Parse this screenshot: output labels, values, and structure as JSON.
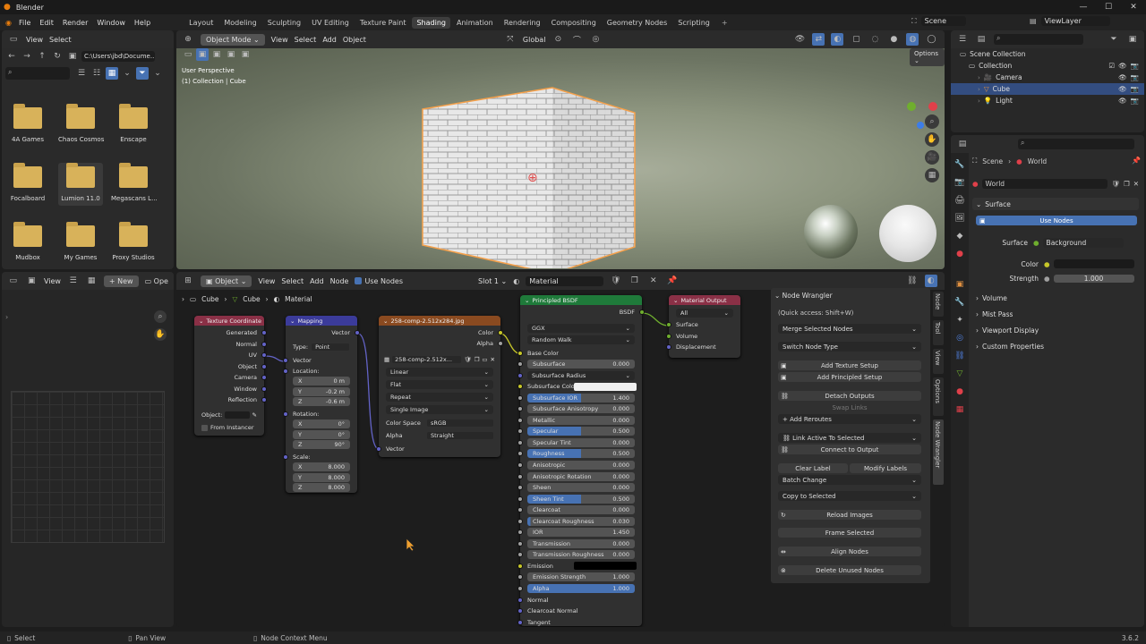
{
  "app": {
    "title": "Blender",
    "version": "3.6.2"
  },
  "menu": [
    "File",
    "Edit",
    "Render",
    "Window",
    "Help"
  ],
  "workspaces": [
    "Layout",
    "Modeling",
    "Sculpting",
    "UV Editing",
    "Texture Paint",
    "Shading",
    "Animation",
    "Rendering",
    "Compositing",
    "Geometry Nodes",
    "Scripting"
  ],
  "active_workspace": "Shading",
  "scene": "Scene",
  "view_layer": "ViewLayer",
  "file_browser": {
    "menu": [
      "View",
      "Select"
    ],
    "path": "C:\\Users\\jbd\\Docume...",
    "folders": [
      "4A Games",
      "Chaos Cosmos",
      "Enscape",
      "Focalboard",
      "Lumion 11.0",
      "Megascans L...",
      "Mudbox",
      "My Games",
      "Proxy Studios"
    ]
  },
  "viewport": {
    "mode": "Object Mode",
    "menu": [
      "View",
      "Select",
      "Add",
      "Object"
    ],
    "transform": "Global",
    "info_line1": "User Perspective",
    "info_line2": "(1) Collection | Cube",
    "options": "Options"
  },
  "outliner": {
    "root": "Scene Collection",
    "items": [
      {
        "label": "Collection",
        "indent": 1
      },
      {
        "label": "Camera",
        "indent": 2
      },
      {
        "label": "Cube",
        "indent": 2
      },
      {
        "label": "Light",
        "indent": 2
      }
    ]
  },
  "properties": {
    "breadcrumb_scene": "Scene",
    "breadcrumb_world": "World",
    "world_name": "World",
    "surface_panel": "Surface",
    "use_nodes": "Use Nodes",
    "surface_label": "Surface",
    "surface_value": "Background",
    "color_label": "Color",
    "strength_label": "Strength",
    "strength_value": "1.000",
    "panels": [
      "Volume",
      "Mist Pass",
      "Viewport Display",
      "Custom Properties"
    ]
  },
  "node_editor": {
    "header": {
      "object": "Object",
      "menu": [
        "View",
        "Select",
        "Add",
        "Node"
      ],
      "use_nodes": "Use Nodes",
      "slot": "Slot 1",
      "material": "Material"
    },
    "breadcrumb": [
      "Cube",
      "Cube",
      "Material"
    ],
    "left_header": {
      "view": "View",
      "new": "New",
      "open": "Ope"
    },
    "tex_coord": {
      "title": "Texture Coordinate",
      "outputs": [
        "Generated",
        "Normal",
        "UV",
        "Object",
        "Camera",
        "Window",
        "Reflection"
      ],
      "object_label": "Object:",
      "from_instancer": "From Instancer"
    },
    "mapping": {
      "title": "Mapping",
      "output": "Vector",
      "type_label": "Type:",
      "type_value": "Point",
      "vector": "Vector",
      "location": "Location:",
      "loc": [
        [
          "X",
          "0 m"
        ],
        [
          "Y",
          "-0.2 m"
        ],
        [
          "Z",
          "-0.6 m"
        ]
      ],
      "rotation": "Rotation:",
      "rot": [
        [
          "X",
          "0°"
        ],
        [
          "Y",
          "0°"
        ],
        [
          "Z",
          "90°"
        ]
      ],
      "scale": "Scale:",
      "scl": [
        [
          "X",
          "8.000"
        ],
        [
          "Y",
          "8.000"
        ],
        [
          "Z",
          "8.000"
        ]
      ]
    },
    "image": {
      "title": "258-comp-2.512x284.jpg",
      "outputs": [
        "Color",
        "Alpha"
      ],
      "image_name": "258-comp-2.512x...",
      "interp": "Linear",
      "proj": "Flat",
      "ext": "Repeat",
      "source": "Single Image",
      "cs_label": "Color Space",
      "cs_value": "sRGB",
      "alpha_label": "Alpha",
      "alpha_value": "Straight",
      "vector": "Vector"
    },
    "bsdf": {
      "title": "Principled BSDF",
      "output": "BSDF",
      "dist": "GGX",
      "sss": "Random Walk",
      "base_color": "Base Color",
      "rows": [
        {
          "label": "Subsurface",
          "value": "0.000",
          "fill": 0
        },
        {
          "label": "Subsurface Radius",
          "value": "",
          "fill": -1
        },
        {
          "label": "Subsurface Color",
          "value": "",
          "fill": -2
        },
        {
          "label": "Subsurface IOR",
          "value": "1.400",
          "fill": 0.5
        },
        {
          "label": "Subsurface Anisotropy",
          "value": "0.000",
          "fill": 0
        },
        {
          "label": "Metallic",
          "value": "0.000",
          "fill": 0
        },
        {
          "label": "Specular",
          "value": "0.500",
          "fill": 0.5
        },
        {
          "label": "Specular Tint",
          "value": "0.000",
          "fill": 0
        },
        {
          "label": "Roughness",
          "value": "0.500",
          "fill": 0.5
        },
        {
          "label": "Anisotropic",
          "value": "0.000",
          "fill": 0
        },
        {
          "label": "Anisotropic Rotation",
          "value": "0.000",
          "fill": 0
        },
        {
          "label": "Sheen",
          "value": "0.000",
          "fill": 0
        },
        {
          "label": "Sheen Tint",
          "value": "0.500",
          "fill": 0.5
        },
        {
          "label": "Clearcoat",
          "value": "0.000",
          "fill": 0
        },
        {
          "label": "Clearcoat Roughness",
          "value": "0.030",
          "fill": 0.03
        },
        {
          "label": "IOR",
          "value": "1.450",
          "fill": 0
        },
        {
          "label": "Transmission",
          "value": "0.000",
          "fill": 0
        },
        {
          "label": "Transmission Roughness",
          "value": "0.000",
          "fill": 0
        },
        {
          "label": "Emission",
          "value": "",
          "fill": -3
        },
        {
          "label": "Emission Strength",
          "value": "1.000",
          "fill": 0
        },
        {
          "label": "Alpha",
          "value": "1.000",
          "fill": 1
        },
        {
          "label": "Normal",
          "value": "",
          "fill": -4
        },
        {
          "label": "Clearcoat Normal",
          "value": "",
          "fill": -4
        },
        {
          "label": "Tangent",
          "value": "",
          "fill": -4
        }
      ]
    },
    "output": {
      "title": "Material Output",
      "target": "All",
      "inputs": [
        "Surface",
        "Volume",
        "Displacement"
      ]
    }
  },
  "node_wrangler": {
    "title": "Node Wrangler",
    "quick": "(Quick access: Shift+W)",
    "merge": "Merge Selected Nodes",
    "switch": "Switch Node Type",
    "add_texture": "Add Texture Setup",
    "add_principled": "Add Principled Setup",
    "detach": "Detach Outputs",
    "swap": "Swap Links",
    "add_reroutes": "Add Reroutes",
    "link_active": "Link Active To Selected",
    "connect": "Connect to Output",
    "clear_label": "Clear Label",
    "modify_labels": "Modify Labels",
    "batch": "Batch Change",
    "copy": "Copy to Selected",
    "reload": "Reload Images",
    "frame": "Frame Selected",
    "align": "Align Nodes",
    "delete": "Delete Unused Nodes",
    "side_tabs": [
      "Node",
      "Tool",
      "View",
      "Options",
      "Node Wrangler"
    ]
  },
  "status": {
    "select": "Select",
    "pan": "Pan View",
    "context": "Node Context Menu"
  }
}
